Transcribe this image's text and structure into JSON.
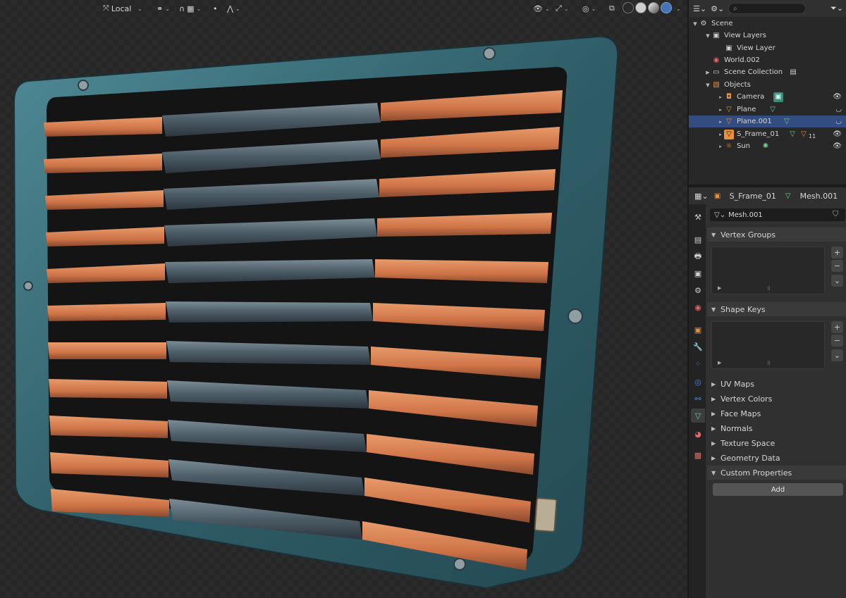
{
  "viewport_header": {
    "transform_orientation": "Local"
  },
  "outliner": {
    "search_placeholder": "",
    "rows": [
      {
        "label": "Scene",
        "icon": "scene-icon"
      },
      {
        "label": "View Layers",
        "icon": "view-layers-icon"
      },
      {
        "label": "View Layer",
        "icon": "view-layer-icon"
      },
      {
        "label": "World.002",
        "icon": "world-icon"
      },
      {
        "label": "Scene Collection",
        "icon": "collection-icon"
      },
      {
        "label": "Objects",
        "icon": "objects-icon"
      },
      {
        "label": "Camera",
        "icon": "camera-icon"
      },
      {
        "label": "Plane",
        "icon": "mesh-icon"
      },
      {
        "label": "Plane.001",
        "icon": "mesh-icon"
      },
      {
        "label": "S_Frame_01",
        "icon": "mesh-icon"
      },
      {
        "label": "Sun",
        "icon": "light-icon"
      }
    ],
    "sframe_modifier_count": "11",
    "selected_row": "Plane.001"
  },
  "properties": {
    "object_name": "S_Frame_01",
    "mesh_name": "Mesh.001",
    "mesh_field": "Mesh.001",
    "panels": {
      "vertex_groups": "Vertex Groups",
      "shape_keys": "Shape Keys",
      "uv_maps": "UV Maps",
      "vertex_colors": "Vertex Colors",
      "face_maps": "Face Maps",
      "normals": "Normals",
      "texture_space": "Texture Space",
      "geometry_data": "Geometry Data",
      "custom_properties": "Custom Properties"
    },
    "add_label": "Add"
  },
  "colors": {
    "selection": "#334d80",
    "accent_green": "#6fd18a",
    "accent_orange": "#e8903a",
    "rust": "#d77a48",
    "metal": "#3d6a74"
  }
}
